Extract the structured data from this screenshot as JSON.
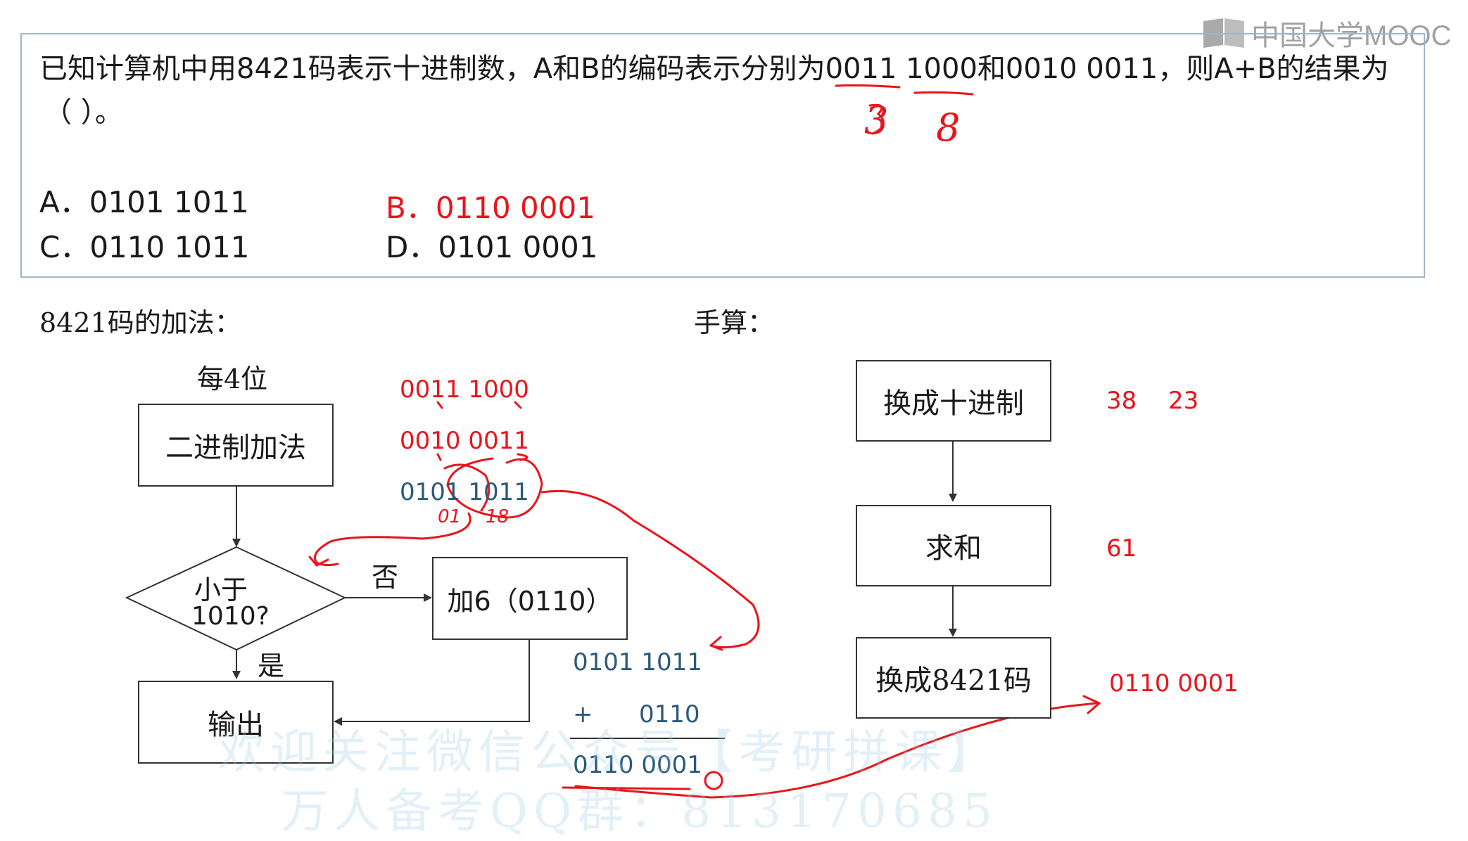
{
  "brand": {
    "name": "中国大学MOOC"
  },
  "question": {
    "line1": "已知计算机中用8421码表示十进制数，A和B的编码表示分别为0011 1000和0010 0011，则A+B的结果为",
    "line2": "（      ）。",
    "options": [
      {
        "label": "A．0101 1011",
        "correct": false
      },
      {
        "label": "B．0110 0001",
        "correct": true
      },
      {
        "label": "C．0110 1011",
        "correct": false
      },
      {
        "label": "D．0101 0001",
        "correct": false
      }
    ],
    "annotations": {
      "a_digit": "3",
      "b_digit": "8"
    }
  },
  "left_section": {
    "title": "8421码的加法：",
    "per_bits": "每4位",
    "box_binary_add": "二进制加法",
    "decision": {
      "line1": "小于",
      "line2": "1010?"
    },
    "no_label": "否",
    "yes_label": "是",
    "box_add6": "加6（0110）",
    "box_output": "输出"
  },
  "calc": {
    "a": "0011 1000",
    "b": "0010 0011",
    "sum": "0101 1011",
    "sum_copy": "0101 1011",
    "plus": "+",
    "add6": "0110",
    "result": "0110  0001",
    "note_left": "01",
    "note_right": "18"
  },
  "right_section": {
    "title": "手算：",
    "box_to_decimal": "换成十进制",
    "box_sum": "求和",
    "box_to_8421": "换成8421码",
    "val_a": "38",
    "val_b": "23",
    "val_sum": "61",
    "val_result": "0110 0001"
  },
  "watermark": {
    "line1": "欢迎关注微信公众号【考研拼课】",
    "line2": "万人备考QQ群：813170685"
  },
  "colors": {
    "annotation_red": "#e8151b",
    "calc_blue": "#2b5a78",
    "box_border": "#9fb6c9"
  }
}
